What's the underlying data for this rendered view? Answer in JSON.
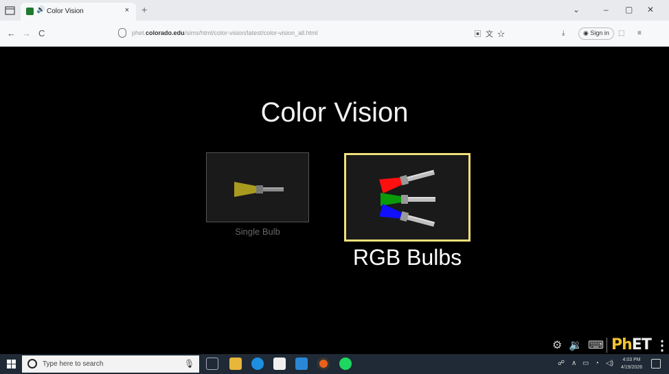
{
  "browser": {
    "tab_title": "Color Vision",
    "tab_audio_icon": "speaker-icon",
    "tab_close": "×",
    "new_tab": "+",
    "window_controls": [
      "⌄",
      "–",
      "▢",
      "✕"
    ],
    "nav": {
      "back": "←",
      "forward": "→",
      "reload": "C"
    },
    "url": {
      "host_prefix": "phet.",
      "host": "colorado.edu",
      "path": "/sims/html/color-vision/latest/color-vision_all.html"
    },
    "url_icons": [
      "reader-view-icon",
      "translate-icon",
      "bookmark-star-icon"
    ],
    "toolbar": {
      "download_icon": "download-icon",
      "signin_label": "Sign in",
      "extensions_icon": "extensions-icon",
      "menu_icon": "menu-icon"
    }
  },
  "sim": {
    "title": "Color Vision",
    "screens": [
      {
        "label": "Single Bulb",
        "selected": false
      },
      {
        "label": "RGB Bulbs",
        "selected": true
      }
    ],
    "bulb_colors": {
      "single": "#a89a1f",
      "red": "#ff0000",
      "green": "#00a000",
      "blue": "#0000ff",
      "selected_border": "#f2e07a"
    },
    "footer": {
      "logo_ph": "Ph",
      "logo_et": "ET",
      "menu": "⋮",
      "icons": [
        "gear-icon",
        "audio-icon",
        "keyboard-icon"
      ]
    }
  },
  "taskbar": {
    "search_placeholder": "Type here to search",
    "apps": [
      "mic-icon",
      "task-view-icon",
      "file-explorer-icon",
      "edge-icon",
      "store-icon",
      "mail-icon",
      "firefox-icon",
      "spotify-icon"
    ],
    "clock_time": "4:03 PM",
    "clock_date": "4/19/2026"
  }
}
